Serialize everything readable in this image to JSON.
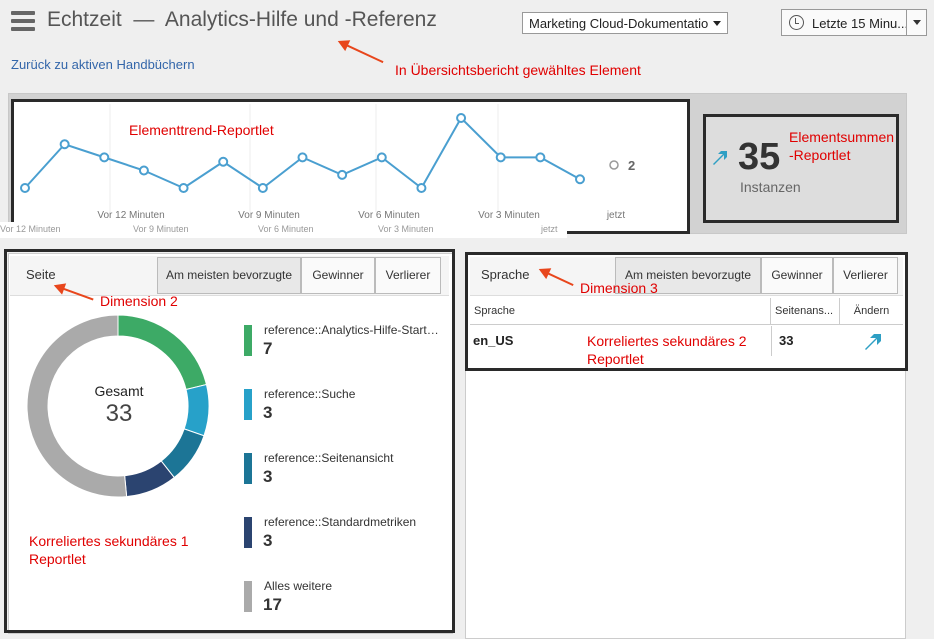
{
  "header": {
    "title": "Echtzeit  —  Analytics-Hilfe und -Referenz",
    "doc_selector": "Marketing Cloud-Dokumentatio",
    "time_range": "Letzte 15 Minu..."
  },
  "nav": {
    "back_link": "Zurück zu aktiven Handbüchern"
  },
  "annotations": {
    "selected_element": "In Übersichtsbericht gewähltes Element",
    "trend_reportlet": "Elementtrend-Reportlet",
    "sum_reportlet_1": "Elementsummen",
    "sum_reportlet_2": "-Reportlet",
    "dimension2": "Dimension 2",
    "dimension3": "Dimension 3",
    "secondary1_line1": "Korreliertes sekundäres 1",
    "secondary1_line2": "Reportlet",
    "secondary2_line1": "Korreliertes sekundäres 2",
    "secondary2_line2": "Reportlet"
  },
  "trend": {
    "values": [
      1,
      2,
      1.7,
      1.4,
      1,
      1.6,
      1,
      1.7,
      1.3,
      1.7,
      1,
      2.6,
      1.7,
      1.7,
      1.2
    ],
    "current_value": "2",
    "x_labels": [
      "Vor 12 Minuten",
      "Vor 9 Minuten",
      "Vor 6 Minuten",
      "Vor 3 Minuten",
      "jetzt"
    ],
    "x_labels_underlay": [
      "Vor 12 Minuten",
      "Vor 9 Minuten",
      "Vor 6 Minuten",
      "Vor 3 Minuten",
      "jetzt"
    ],
    "line_color": "#4a9fd0"
  },
  "summary": {
    "value": "35",
    "caption": "Instanzen",
    "trend_color": "#2e9fc4"
  },
  "left_panel": {
    "dimension_label": "Seite",
    "buttons": [
      "Am meisten bevorzugte",
      "Gewinner",
      "Verlierer"
    ],
    "donut": {
      "title": "Gesamt",
      "total": "33"
    },
    "items": [
      {
        "label": "reference::Analytics-Hilfe-Startseite",
        "value": "7",
        "color": "#3daa66"
      },
      {
        "label": "reference::Suche",
        "value": "3",
        "color": "#27a1c9"
      },
      {
        "label": "reference::Seitenansicht",
        "value": "3",
        "color": "#1c7596"
      },
      {
        "label": "reference::Standardmetriken",
        "value": "3",
        "color": "#2b4470"
      },
      {
        "label": "Alles weitere",
        "value": "17",
        "color": "#aaaaaa"
      }
    ]
  },
  "right_panel": {
    "dimension_label": "Sprache",
    "buttons": [
      "Am meisten bevorzugte",
      "Gewinner",
      "Verlierer"
    ],
    "columns": [
      "Sprache",
      "Seitenans...",
      "Ändern"
    ],
    "rows": [
      {
        "language": "en_US",
        "pageviews": "33"
      }
    ]
  }
}
